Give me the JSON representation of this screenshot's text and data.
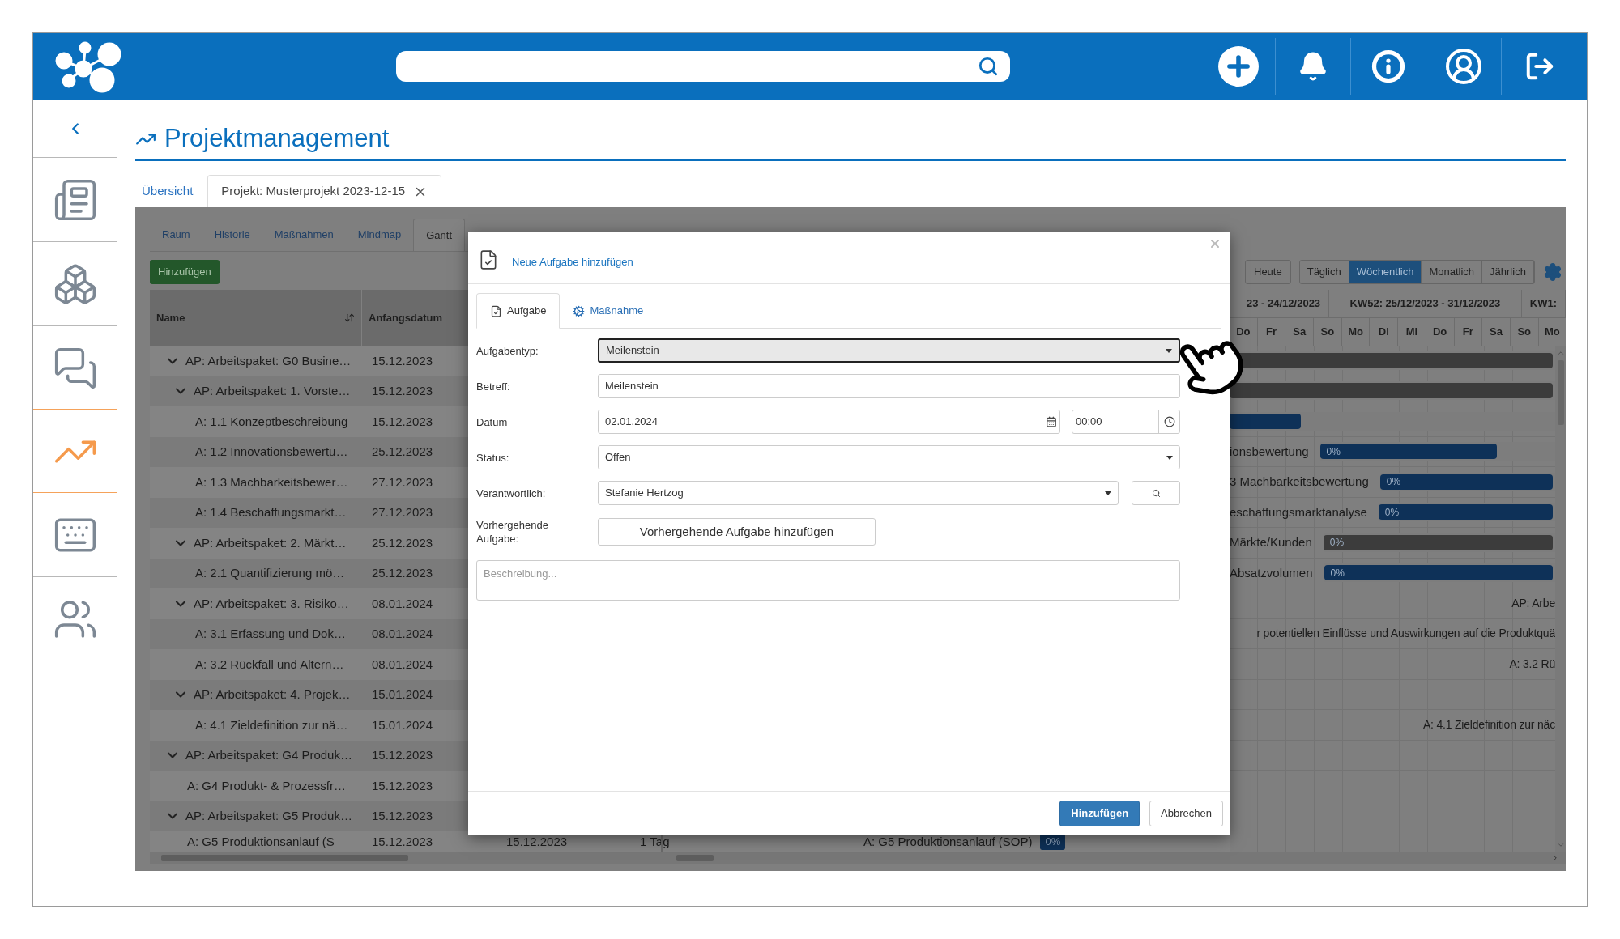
{
  "sidebar": {
    "items": [
      {
        "kind": "news",
        "selected": false
      },
      {
        "kind": "cubes",
        "selected": false
      },
      {
        "kind": "chat",
        "selected": false
      },
      {
        "kind": "chart",
        "selected": true
      },
      {
        "kind": "keyboard",
        "selected": false
      },
      {
        "kind": "people",
        "selected": false
      }
    ]
  },
  "page": {
    "title": "Projektmanagement"
  },
  "tabs": [
    {
      "label": "Übersicht",
      "selected": false
    },
    {
      "label": "Projekt: Musterprojekt 2023-12-15",
      "selected": true
    }
  ],
  "project_tabs": [
    {
      "label": "Raum",
      "selected": false
    },
    {
      "label": "Historie",
      "selected": false
    },
    {
      "label": "Maßnahmen",
      "selected": false
    },
    {
      "label": "Mindmap",
      "selected": false
    },
    {
      "label": "Gantt",
      "selected": true
    }
  ],
  "add_button": "Hinzufügen",
  "table": {
    "columns": [
      "Name",
      "Anfangsdatum"
    ],
    "rows": [
      {
        "name": "AP: Arbeitspaket: G0 Busine…",
        "start": "15.12.2023",
        "expanded": true,
        "children": [
          {
            "name": "AP: Arbeitspaket: 1. Vorste…",
            "start": "15.12.2023",
            "expanded": true,
            "children": [
              {
                "name": "A: 1.1 Konzeptbeschreibung",
                "start": "15.12.2023"
              },
              {
                "name": "A: 1.2 Innovationsbewertu…",
                "start": "25.12.2023"
              },
              {
                "name": "A: 1.3 Machbarkeitsbewer…",
                "start": "27.12.2023"
              },
              {
                "name": "A: 1.4 Beschaffungsmarkt…",
                "start": "27.12.2023"
              }
            ]
          },
          {
            "name": "AP: Arbeitspaket: 2. Märkt…",
            "start": "25.12.2023",
            "expanded": true,
            "children": [
              {
                "name": "A: 2.1 Quantifizierung mö…",
                "start": "25.12.2023"
              }
            ]
          },
          {
            "name": "AP: Arbeitspaket: 3. Risiko…",
            "start": "08.01.2024",
            "expanded": true,
            "children": [
              {
                "name": "A: 3.1 Erfassung und Dok…",
                "start": "08.01.2024"
              },
              {
                "name": "A: 3.2 Rückfall und Altern…",
                "start": "08.01.2024"
              }
            ]
          },
          {
            "name": "AP: Arbeitspaket: 4. Projek…",
            "start": "15.01.2024",
            "expanded": true,
            "children": [
              {
                "name": "A: 4.1 Zieldefinition zur nä…",
                "start": "15.01.2024"
              }
            ]
          }
        ]
      },
      {
        "name": "AP: Arbeitspaket: G4 Produk…",
        "start": "15.12.2023",
        "expanded": true,
        "children": [
          {
            "name": "A: G4 Produkt- & Prozessfr…",
            "start": "15.12.2023"
          }
        ]
      },
      {
        "name": "AP: Arbeitspaket: G5 Produk…",
        "start": "15.12.2023",
        "expanded": true,
        "children": [
          {
            "name": "A: G5 Produktionsanlauf (S",
            "start": "15.12.2023",
            "end": "15.12.2023",
            "duration": "1 Tag",
            "bar_label": "A: G5 Produktionsanlauf (SOP)",
            "bar_text": "0%"
          }
        ]
      }
    ]
  },
  "gantt": {
    "view_buttons": [
      {
        "label": "Heute",
        "kind": "single",
        "selected": false
      },
      {
        "label": "Täglich",
        "kind": "group",
        "selected": false
      },
      {
        "label": "Wöchentlich",
        "kind": "group",
        "selected": true
      },
      {
        "label": "Monatlich",
        "kind": "group",
        "selected": false
      },
      {
        "label": "Jährlich",
        "kind": "group",
        "selected": false
      }
    ],
    "weeks": [
      "23 - 24/12/2023",
      "KW52: 25/12/2023 - 31/12/2023",
      "KW1:"
    ],
    "days": [
      "Do",
      "Fr",
      "Sa",
      "So",
      "Mo",
      "Di",
      "Mi",
      "Do",
      "Fr",
      "Sa",
      "So",
      "Mo"
    ],
    "rows": [
      {
        "kind": "bar",
        "color": "#3c3c3c",
        "level": 1
      },
      {
        "kind": "bar",
        "color": "#3c3c3c",
        "level": 1
      },
      {
        "kind": "bar",
        "color": "#0e3158",
        "level": 0.22
      },
      {
        "kind": "bar",
        "label": "ionsbewertung",
        "text": "0%",
        "color": "#0e3158",
        "level": 0.76
      },
      {
        "kind": "bar",
        "label": "3 Machbarkeitsbewertung",
        "text": "0%",
        "color": "#0e3158",
        "level": 1
      },
      {
        "kind": "bar",
        "label": "eschaffungsmarktanalyse",
        "text": "0%",
        "color": "#0e3158",
        "level": 1
      },
      {
        "kind": "bar",
        "label": "Märkte/Kunden",
        "text": "0%",
        "color": "#3c3c3c",
        "level": 1
      },
      {
        "kind": "bar",
        "label": "Absatzvolumen",
        "text": "0%",
        "color": "#0e3158",
        "level": 1
      },
      {
        "kind": "label",
        "label": "AP: Arbe"
      },
      {
        "kind": "label",
        "label": "r potentiellen Einflüsse und Auswirkungen auf die Produktquä"
      },
      {
        "kind": "label",
        "label": "A: 3.2 Rü"
      },
      {
        "kind": "empty"
      },
      {
        "kind": "label",
        "label": "A: 4.1 Zieldefinition zur näc"
      },
      {
        "kind": "empty"
      },
      {
        "kind": "empty"
      },
      {
        "kind": "empty"
      }
    ]
  },
  "dialog": {
    "title": "Neue Aufgabe hinzufügen",
    "tabs": [
      {
        "label": "Aufgabe",
        "kind": "task",
        "selected": true
      },
      {
        "label": "Maßnahme",
        "kind": "measure",
        "selected": false
      }
    ],
    "fields": [
      {
        "kind": "select",
        "label": "Aufgabentyp:",
        "value": "Meilenstein",
        "focused": true
      },
      {
        "kind": "input",
        "label": "Betreff:",
        "value": "Meilenstein"
      },
      {
        "kind": "datetime",
        "label": "Datum",
        "value": "02.01.2024",
        "time": "00:00"
      },
      {
        "kind": "select",
        "label": "Status:",
        "value": "Offen",
        "focused": false
      },
      {
        "kind": "select-search",
        "label": "Verantwortlich:",
        "value": "Stefanie Hertzog"
      },
      {
        "kind": "button",
        "label": "Vorhergehende Aufgabe:",
        "button": "Vorhergehende Aufgabe hinzufügen"
      }
    ],
    "description": {
      "placeholder": "Beschreibung..."
    },
    "buttons": [
      {
        "label": "Hinzufügen",
        "kind": "primary"
      },
      {
        "label": "Abbrechen",
        "kind": "default"
      }
    ]
  }
}
